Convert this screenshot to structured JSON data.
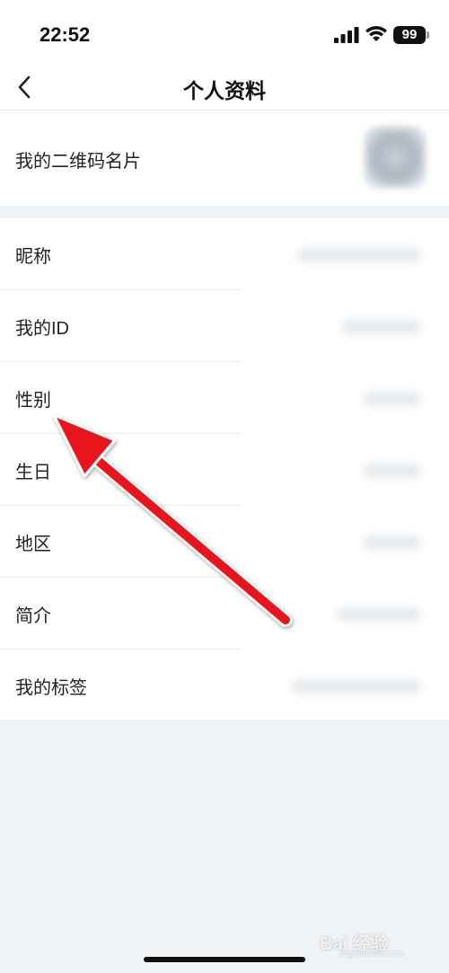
{
  "status_bar": {
    "time": "22:52",
    "battery": "99",
    "icons": [
      "signal-icon",
      "wifi-icon",
      "battery-icon"
    ]
  },
  "nav": {
    "back_icon": "chevron-left-icon",
    "title": "个人资料"
  },
  "qr_card": {
    "label": "我的二维码名片"
  },
  "rows": [
    {
      "label": "昵称"
    },
    {
      "label": "我的ID"
    },
    {
      "label": "性别"
    },
    {
      "label": "生日"
    },
    {
      "label": "地区"
    },
    {
      "label": "简介"
    },
    {
      "label": "我的标签"
    }
  ],
  "annotation": {
    "arrow_color": "#e8171c",
    "points_to": "性别"
  },
  "watermark": {
    "logo": "Bai 经验",
    "sub": "jingyan.baidu.com"
  }
}
